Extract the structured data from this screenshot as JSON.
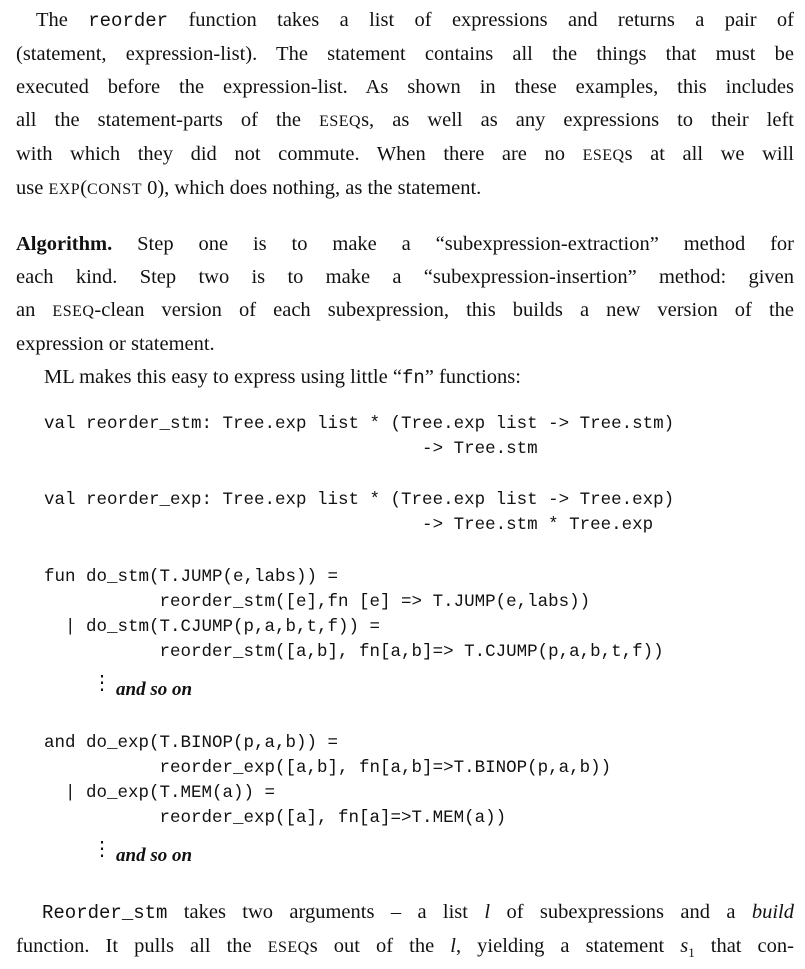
{
  "para1": {
    "l1a": "The ",
    "l1code": "reorder",
    "l1b": " function takes a list of expressions and returns a pair of",
    "l2": "(statement, expression-list). The statement contains all the things that must be",
    "l3": "executed before the expression-list. As shown in these examples, this includes",
    "l4a": "all the statement-parts of the ",
    "l4sc": "ESEQ",
    "l4b": "s, as well as any expressions to their left",
    "l5a": "with which they did not commute. When there are no ",
    "l5sc": "ESEQ",
    "l5b": "s at all we will",
    "l6a": "use ",
    "l6sc1": "EXP",
    "l6b": "(",
    "l6sc2": "CONST",
    "l6c": " 0), which does nothing, as the statement."
  },
  "para2": {
    "heading": "Algorithm.",
    "l1": " Step one is to make a “subexpression-extraction” method for",
    "l2": "each kind. Step two is to make a “subexpression-insertion” method: given",
    "l3a": "an ",
    "l3sc": "ESEQ",
    "l3b": "-clean version of each subexpression, this builds a new version of the",
    "l4": "expression or statement.",
    "l5a": "ML makes this easy to express using little “",
    "l5code": "fn",
    "l5b": "” functions:"
  },
  "code": {
    "c1": "val reorder_stm: Tree.exp list * (Tree.exp list -> Tree.stm)",
    "c2": "                                    -> Tree.stm",
    "c3": "val reorder_exp: Tree.exp list * (Tree.exp list -> Tree.exp)",
    "c4": "                                    -> Tree.stm * Tree.exp",
    "c5": "fun do_stm(T.JUMP(e,labs)) =",
    "c6": "           reorder_stm([e],fn [e] => T.JUMP(e,labs))",
    "c7": "  | do_stm(T.CJUMP(p,a,b,t,f)) =",
    "c8": "           reorder_stm([a,b], fn[a,b]=> T.CJUMP(p,a,b,t,f))",
    "c9": "and do_exp(T.BINOP(p,a,b)) =",
    "c10": "           reorder_exp([a,b], fn[a,b]=>T.BINOP(p,a,b))",
    "c11": "  | do_exp(T.MEM(a)) =",
    "c12": "           reorder_exp([a], fn[a]=>T.MEM(a))",
    "etc1": "and so on",
    "etc2": "and so on",
    "dots": "⋮"
  },
  "para3": {
    "l1code": "Reorder_stm",
    "l1a": " takes two arguments – a list ",
    "l1i": "l",
    "l1b": " of subexpressions and a ",
    "l1build": "build",
    "l2a": "function. It pulls all the ",
    "l2sc": "ESEQ",
    "l2b": "s out of the ",
    "l2i": "l",
    "l2c": ", yielding a statement ",
    "l2s": "s",
    "l2sub": "1",
    "l2d": " that con-"
  }
}
